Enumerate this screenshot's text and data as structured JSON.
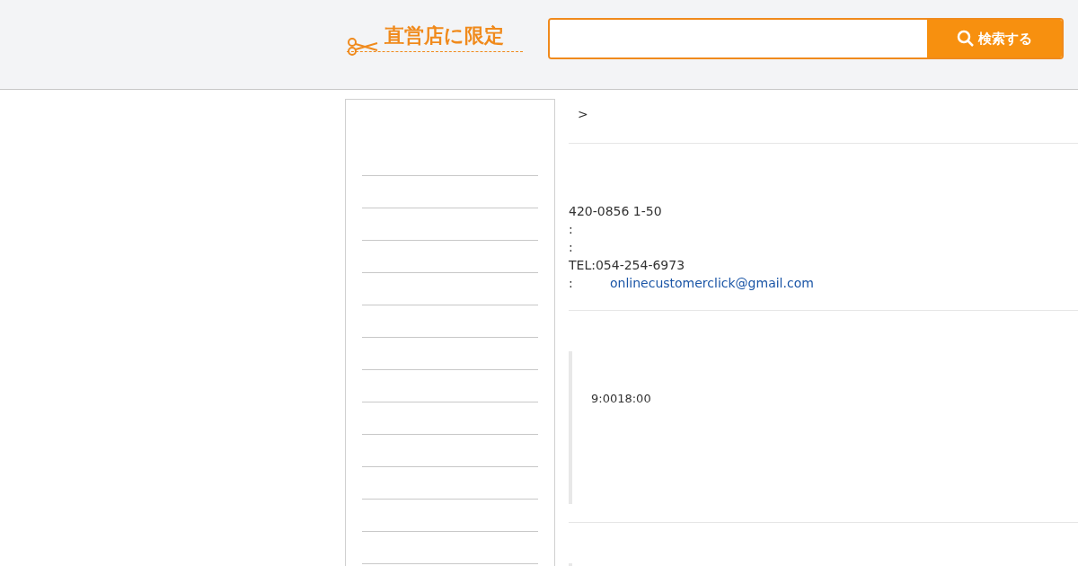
{
  "header": {
    "logo_text": "直営店に限定",
    "search": {
      "button_label": "検索する"
    }
  },
  "breadcrumb": {
    "separator": ">"
  },
  "address": {
    "lines": [
      "420-0856 1-50",
      ":",
      ":",
      "TEL:054-254-6973"
    ],
    "email_label": ":",
    "email": "onlinecustomerclick@gmail.com"
  },
  "hours": {
    "text": "9:0018:00"
  }
}
